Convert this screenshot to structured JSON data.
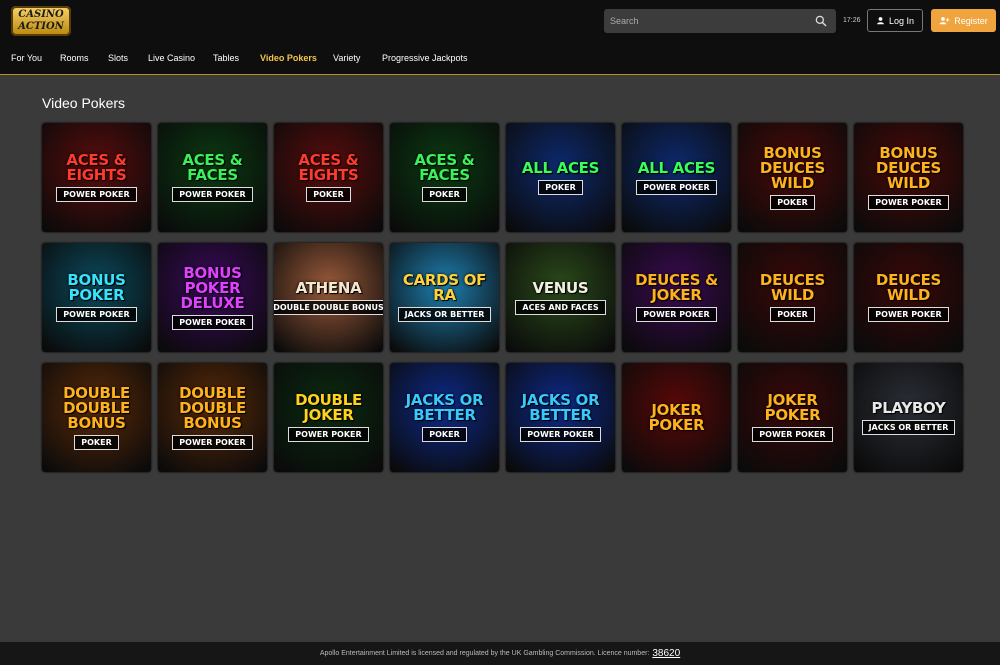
{
  "brand": {
    "logo_line1": "CASINO",
    "logo_line2": "ACTION"
  },
  "header": {
    "search_placeholder": "Search",
    "time": "17:26",
    "login_label": "Log In",
    "register_label": "Register"
  },
  "nav": {
    "items": [
      {
        "label": "For You"
      },
      {
        "label": "Rooms"
      },
      {
        "label": "Slots"
      },
      {
        "label": "Live Casino"
      },
      {
        "label": "Tables"
      },
      {
        "label": "Video Pokers"
      },
      {
        "label": "Variety"
      },
      {
        "label": "Progressive Jackpots"
      }
    ],
    "active": "Video Pokers"
  },
  "page": {
    "title": "Video Pokers"
  },
  "games": [
    {
      "title": "ACES & EIGHTS",
      "sub": "POWER POKER",
      "color": "#ff3b2f",
      "bg": "#5a0c0c"
    },
    {
      "title": "ACES & FACES",
      "sub": "POWER POKER",
      "color": "#3cf05a",
      "bg": "#0b3a12"
    },
    {
      "title": "ACES & EIGHTS",
      "sub": "POKER",
      "color": "#ff3b2f",
      "bg": "#5a0c0c"
    },
    {
      "title": "ACES & FACES",
      "sub": "POKER",
      "color": "#3cf05a",
      "bg": "#0b3a12"
    },
    {
      "title": "ALL ACES",
      "sub": "POKER",
      "color": "#36ff5a",
      "bg": "#0d2a6e"
    },
    {
      "title": "ALL ACES",
      "sub": "POWER POKER",
      "color": "#36ff5a",
      "bg": "#0d2a6e"
    },
    {
      "title": "BONUS DEUCES WILD",
      "sub": "POKER",
      "color": "#ffb21e",
      "bg": "#4a0a08"
    },
    {
      "title": "BONUS DEUCES WILD",
      "sub": "POWER POKER",
      "color": "#ffb21e",
      "bg": "#4a0a08"
    },
    {
      "title": "BONUS POKER",
      "sub": "POWER POKER",
      "color": "#38e2ff",
      "bg": "#0b4a5c"
    },
    {
      "title": "BONUS POKER DELUXE",
      "sub": "POWER POKER",
      "color": "#e040ff",
      "bg": "#3a0a5c"
    },
    {
      "title": "ATHENA",
      "sub": "DOUBLE DOUBLE BONUS",
      "color": "#f4e7d0",
      "bg": "#9a5a3a"
    },
    {
      "title": "CARDS OF RA",
      "sub": "JACKS OR BETTER",
      "color": "#ffd23c",
      "bg": "#1e7fb0"
    },
    {
      "title": "VENUS",
      "sub": "ACES AND FACES",
      "color": "#f0f0e0",
      "bg": "#2a4a1a"
    },
    {
      "title": "DEUCES & JOKER",
      "sub": "POWER POKER",
      "color": "#ffb21e",
      "bg": "#3a0a52"
    },
    {
      "title": "DEUCES WILD",
      "sub": "POKER",
      "color": "#ffb21e",
      "bg": "#3a0808"
    },
    {
      "title": "DEUCES WILD",
      "sub": "POWER POKER",
      "color": "#ffb21e",
      "bg": "#3a0808"
    },
    {
      "title": "DOUBLE DOUBLE BONUS",
      "sub": "POKER",
      "color": "#ffb21e",
      "bg": "#5a2a08"
    },
    {
      "title": "DOUBLE DOUBLE BONUS",
      "sub": "POWER POKER",
      "color": "#ffb21e",
      "bg": "#5a2a08"
    },
    {
      "title": "DOUBLE JOKER",
      "sub": "POWER POKER",
      "color": "#ffd21e",
      "bg": "#0b2a10"
    },
    {
      "title": "JACKS OR BETTER",
      "sub": "POKER",
      "color": "#38c8ff",
      "bg": "#0d2a8a"
    },
    {
      "title": "JACKS OR BETTER",
      "sub": "POWER POKER",
      "color": "#38c8ff",
      "bg": "#0d2a8a"
    },
    {
      "title": "JOKER POKER",
      "sub": "",
      "color": "#ffb21e",
      "bg": "#5a0808"
    },
    {
      "title": "JOKER POKER",
      "sub": "POWER POKER",
      "color": "#ffb21e",
      "bg": "#3a0808"
    },
    {
      "title": "PLAYBOY",
      "sub": "JACKS OR BETTER",
      "color": "#e8e8e8",
      "bg": "#2a2e36"
    }
  ],
  "footer": {
    "text": "Apollo Entertainment Limited is licensed and regulated by the UK Gambling Commission. Licence number:",
    "licence": "38620"
  }
}
